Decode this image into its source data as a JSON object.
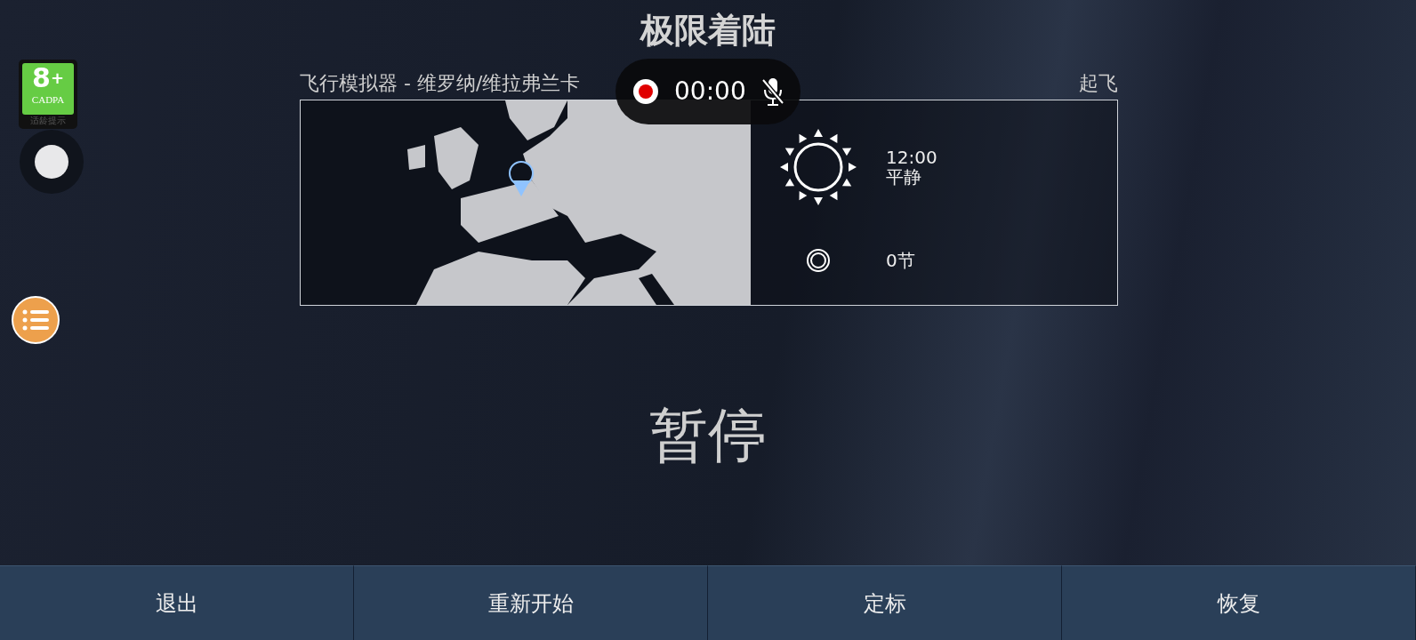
{
  "title": "极限着陆",
  "age_badge": {
    "rating": "8",
    "plus": "+",
    "org": "CADPA",
    "caption": "适龄提示"
  },
  "mission": {
    "name": "飞行模拟器 - 维罗纳/维拉弗兰卡",
    "phase": "起飞",
    "weather": [
      {
        "kind": "sun",
        "lines": [
          "12:00",
          "平静"
        ]
      },
      {
        "kind": "wind",
        "lines": [
          "0节"
        ]
      }
    ]
  },
  "recorder": {
    "time": "00:00",
    "recording": true,
    "mic_muted": true
  },
  "status": "暂停",
  "buttons": [
    "退出",
    "重新开始",
    "定标",
    "恢复"
  ]
}
